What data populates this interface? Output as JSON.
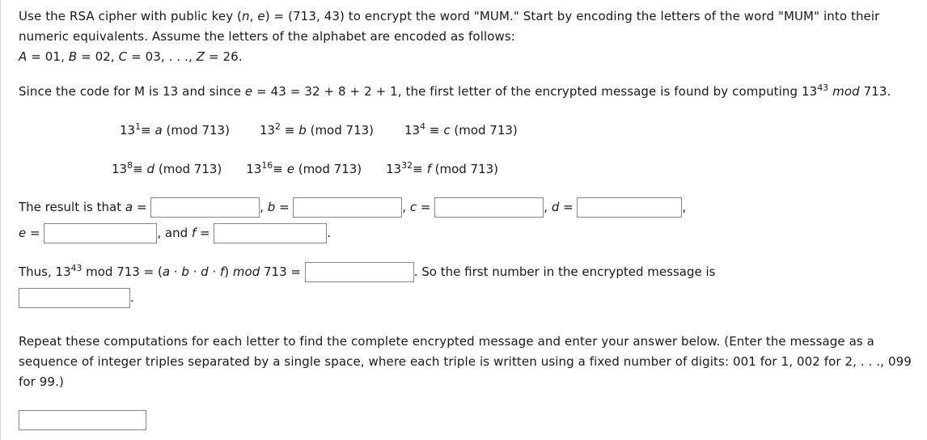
{
  "problem": {
    "intro": {
      "line1": "Use the RSA cipher with public key (",
      "n_var": "n",
      "comma1": ", ",
      "e_var": "e",
      "line1b": ") = (713, 43) to encrypt the word \"MUM.\" Start by encoding the letters of the word \"MUM\" into their numeric equivalents. Assume the letters of the alphabet are encoded as follows:",
      "alphabet_A": "A",
      "alphabet_A_val": " = 01, ",
      "alphabet_B": "B",
      "alphabet_B_val": " = 02, ",
      "alphabet_C": "C",
      "alphabet_C_val": " = 03, . . ., ",
      "alphabet_Z": "Z",
      "alphabet_Z_val": " = 26."
    },
    "since": {
      "part1": "Since the code for M is 13 and since ",
      "e_var": "e",
      "part2": " = 43 = 32 + 8 + 2 + 1, the first letter of the encrypted message is found by computing 13",
      "exp": "43",
      "mod_ital": "mod",
      "part3": " 713."
    },
    "congruences": {
      "base": "13",
      "equiv": "≡",
      "modtext": "(mod 713)",
      "row1": [
        {
          "exp": "1",
          "var": "a"
        },
        {
          "exp": "2",
          "var": "b"
        },
        {
          "exp": "4",
          "var": "c"
        }
      ],
      "row2": [
        {
          "exp": "8",
          "var": "d"
        },
        {
          "exp": "16",
          "var": "e"
        },
        {
          "exp": "32",
          "var": "f"
        }
      ]
    },
    "result": {
      "lead": "The result is that ",
      "a_label": "a",
      "a_eq": " = ",
      "b_sep": ", ",
      "b_label": "b",
      "b_eq": " = ",
      "c_sep": ", ",
      "c_label": "c",
      "c_eq": " = ",
      "d_sep": ", ",
      "d_label": "d",
      "d_eq": " = ",
      "trail_comma": ",",
      "e_label": "e",
      "e_eq": " = ",
      "and_text": ", and ",
      "f_label": "f",
      "f_eq": " = ",
      "period": ".",
      "a_value": "",
      "b_value": "",
      "c_value": "",
      "d_value": "",
      "e_value": "",
      "f_value": ""
    },
    "thus": {
      "part1": "Thus, 13",
      "exp": "43",
      "part2": " mod 713 = (",
      "a": "a",
      "dot1": " · ",
      "b": "b",
      "dot2": " · ",
      "d": "d",
      "dot3": " · ",
      "f": "f",
      "part3": ") ",
      "mod_ital": "mod",
      "part4": " 713 = ",
      "value1": "",
      "part5": ". So the first number in the encrypted message is",
      "value2": "",
      "period": "."
    },
    "repeat": {
      "text": "Repeat these computations for each letter to find the complete encrypted message and enter your answer below. (Enter the message as a sequence of integer triples separated by a single space, where each triple is written using a fixed number of digits: 001 for 1, 002 for 2, . . ., 099 for 99.)",
      "answer_value": ""
    }
  },
  "colors": {
    "text": "#1a1a1a",
    "input_border": "#878787",
    "page_border": "#d4d4d4",
    "background": "#ffffff"
  }
}
